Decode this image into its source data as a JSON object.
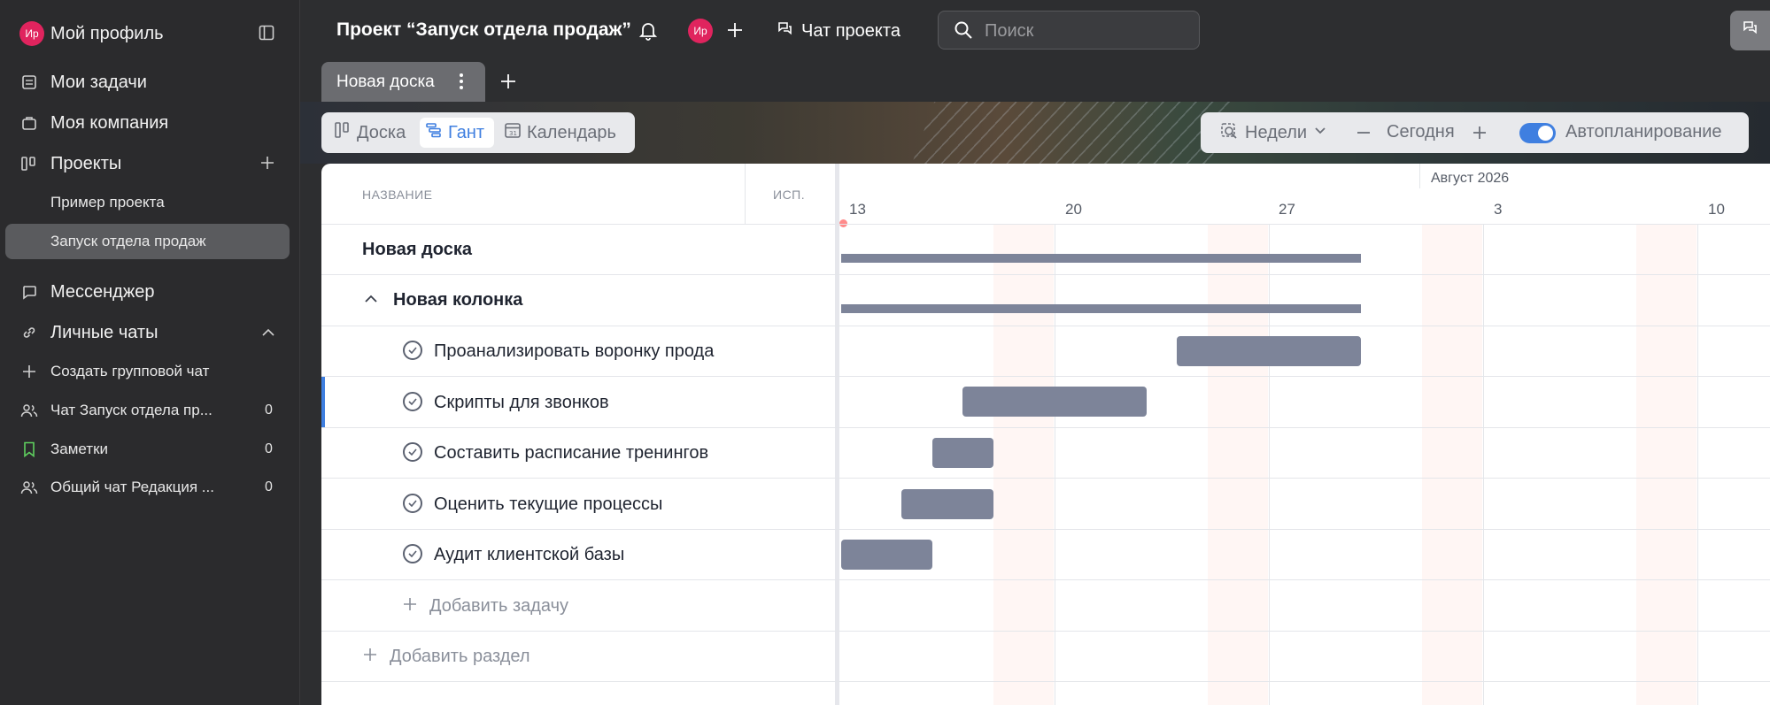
{
  "sidebar": {
    "profile": {
      "avatar": "Ир",
      "label": "Мой профиль"
    },
    "items": [
      {
        "label": "Мои задачи",
        "icon": "tasks-icon"
      },
      {
        "label": "Моя компания",
        "icon": "company-icon"
      },
      {
        "label": "Проекты",
        "icon": "projects-icon"
      }
    ],
    "projects": [
      {
        "label": "Пример проекта"
      },
      {
        "label": "Запуск отдела продаж",
        "selected": true
      }
    ],
    "messenger": "Мессенджер",
    "personal_chats": "Личные чаты",
    "create_group": "Создать групповой чат",
    "chats": [
      {
        "label": "Чат Запуск отдела пр...",
        "count": "0",
        "icon": "users-icon"
      },
      {
        "label": "Заметки",
        "count": "0",
        "icon": "bookmark-icon"
      },
      {
        "label": "Общий чат Редакция ...",
        "count": "0",
        "icon": "users-icon"
      }
    ]
  },
  "topbar": {
    "project_title": "Проект “Запуск отдела продаж”",
    "member_avatar": "Ир",
    "project_chat": "Чат проекта",
    "search_placeholder": "Поиск"
  },
  "tabs": {
    "active": "Новая доска"
  },
  "views": {
    "board": "Доска",
    "gantt": "Гант",
    "calendar": "Календарь",
    "active": "Гант"
  },
  "controls": {
    "scale": "Недели",
    "today": "Сегодня",
    "autoplan": "Автопланирование",
    "autoplan_on": true
  },
  "colors": {
    "accent": "#3f7fe0",
    "bar": "#7d8499",
    "avatar": "#e0245e",
    "weekend": "#fff6f4"
  },
  "gantt": {
    "col_name": "НАЗВАНИЕ",
    "col_assignee": "ИСП.",
    "month": "Август 2026",
    "days": [
      "13",
      "20",
      "27",
      "3",
      "10"
    ],
    "board": "Новая доска",
    "column": "Новая колонка",
    "tasks": [
      {
        "name": "Проанализировать воронку прода"
      },
      {
        "name": "Скрипты для звонков"
      },
      {
        "name": "Составить расписание тренингов"
      },
      {
        "name": "Оценить текущие процессы"
      },
      {
        "name": "Аудит клиентской базы"
      }
    ],
    "add_task": "Добавить задачу",
    "add_section": "Добавить раздел"
  }
}
